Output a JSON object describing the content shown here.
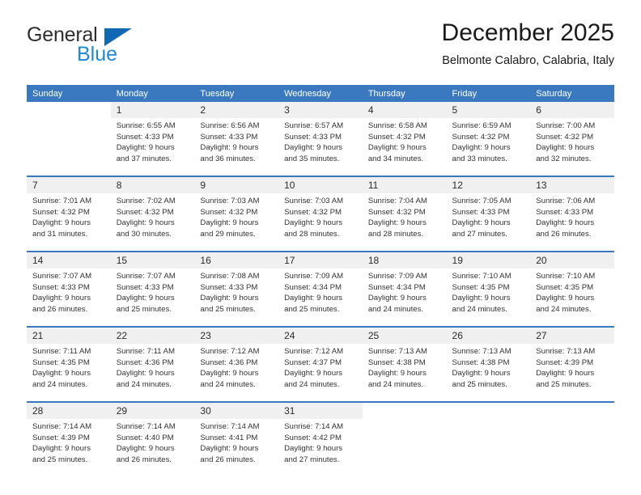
{
  "brand": {
    "name_part1": "General",
    "name_part2": "Blue",
    "triangle_color": "#1268b3",
    "blue_text_color": "#1e88d8"
  },
  "header": {
    "title": "December 2025",
    "location": "Belmonte Calabro, Calabria, Italy"
  },
  "theme": {
    "header_row_bg": "#3a79bf",
    "daynum_bg": "#f0f0f0",
    "cell_bg": "#ffffff",
    "text": "#333333"
  },
  "weekdays": [
    "Sunday",
    "Monday",
    "Tuesday",
    "Wednesday",
    "Thursday",
    "Friday",
    "Saturday"
  ],
  "weeks": [
    [
      {
        "day": "",
        "sunrise": "",
        "sunset": "",
        "daylight_line1": "",
        "daylight_line2": ""
      },
      {
        "day": "1",
        "sunrise": "Sunrise: 6:55 AM",
        "sunset": "Sunset: 4:33 PM",
        "daylight_line1": "Daylight: 9 hours",
        "daylight_line2": "and 37 minutes."
      },
      {
        "day": "2",
        "sunrise": "Sunrise: 6:56 AM",
        "sunset": "Sunset: 4:33 PM",
        "daylight_line1": "Daylight: 9 hours",
        "daylight_line2": "and 36 minutes."
      },
      {
        "day": "3",
        "sunrise": "Sunrise: 6:57 AM",
        "sunset": "Sunset: 4:33 PM",
        "daylight_line1": "Daylight: 9 hours",
        "daylight_line2": "and 35 minutes."
      },
      {
        "day": "4",
        "sunrise": "Sunrise: 6:58 AM",
        "sunset": "Sunset: 4:32 PM",
        "daylight_line1": "Daylight: 9 hours",
        "daylight_line2": "and 34 minutes."
      },
      {
        "day": "5",
        "sunrise": "Sunrise: 6:59 AM",
        "sunset": "Sunset: 4:32 PM",
        "daylight_line1": "Daylight: 9 hours",
        "daylight_line2": "and 33 minutes."
      },
      {
        "day": "6",
        "sunrise": "Sunrise: 7:00 AM",
        "sunset": "Sunset: 4:32 PM",
        "daylight_line1": "Daylight: 9 hours",
        "daylight_line2": "and 32 minutes."
      }
    ],
    [
      {
        "day": "7",
        "sunrise": "Sunrise: 7:01 AM",
        "sunset": "Sunset: 4:32 PM",
        "daylight_line1": "Daylight: 9 hours",
        "daylight_line2": "and 31 minutes."
      },
      {
        "day": "8",
        "sunrise": "Sunrise: 7:02 AM",
        "sunset": "Sunset: 4:32 PM",
        "daylight_line1": "Daylight: 9 hours",
        "daylight_line2": "and 30 minutes."
      },
      {
        "day": "9",
        "sunrise": "Sunrise: 7:03 AM",
        "sunset": "Sunset: 4:32 PM",
        "daylight_line1": "Daylight: 9 hours",
        "daylight_line2": "and 29 minutes."
      },
      {
        "day": "10",
        "sunrise": "Sunrise: 7:03 AM",
        "sunset": "Sunset: 4:32 PM",
        "daylight_line1": "Daylight: 9 hours",
        "daylight_line2": "and 28 minutes."
      },
      {
        "day": "11",
        "sunrise": "Sunrise: 7:04 AM",
        "sunset": "Sunset: 4:32 PM",
        "daylight_line1": "Daylight: 9 hours",
        "daylight_line2": "and 28 minutes."
      },
      {
        "day": "12",
        "sunrise": "Sunrise: 7:05 AM",
        "sunset": "Sunset: 4:33 PM",
        "daylight_line1": "Daylight: 9 hours",
        "daylight_line2": "and 27 minutes."
      },
      {
        "day": "13",
        "sunrise": "Sunrise: 7:06 AM",
        "sunset": "Sunset: 4:33 PM",
        "daylight_line1": "Daylight: 9 hours",
        "daylight_line2": "and 26 minutes."
      }
    ],
    [
      {
        "day": "14",
        "sunrise": "Sunrise: 7:07 AM",
        "sunset": "Sunset: 4:33 PM",
        "daylight_line1": "Daylight: 9 hours",
        "daylight_line2": "and 26 minutes."
      },
      {
        "day": "15",
        "sunrise": "Sunrise: 7:07 AM",
        "sunset": "Sunset: 4:33 PM",
        "daylight_line1": "Daylight: 9 hours",
        "daylight_line2": "and 25 minutes."
      },
      {
        "day": "16",
        "sunrise": "Sunrise: 7:08 AM",
        "sunset": "Sunset: 4:33 PM",
        "daylight_line1": "Daylight: 9 hours",
        "daylight_line2": "and 25 minutes."
      },
      {
        "day": "17",
        "sunrise": "Sunrise: 7:09 AM",
        "sunset": "Sunset: 4:34 PM",
        "daylight_line1": "Daylight: 9 hours",
        "daylight_line2": "and 25 minutes."
      },
      {
        "day": "18",
        "sunrise": "Sunrise: 7:09 AM",
        "sunset": "Sunset: 4:34 PM",
        "daylight_line1": "Daylight: 9 hours",
        "daylight_line2": "and 24 minutes."
      },
      {
        "day": "19",
        "sunrise": "Sunrise: 7:10 AM",
        "sunset": "Sunset: 4:35 PM",
        "daylight_line1": "Daylight: 9 hours",
        "daylight_line2": "and 24 minutes."
      },
      {
        "day": "20",
        "sunrise": "Sunrise: 7:10 AM",
        "sunset": "Sunset: 4:35 PM",
        "daylight_line1": "Daylight: 9 hours",
        "daylight_line2": "and 24 minutes."
      }
    ],
    [
      {
        "day": "21",
        "sunrise": "Sunrise: 7:11 AM",
        "sunset": "Sunset: 4:35 PM",
        "daylight_line1": "Daylight: 9 hours",
        "daylight_line2": "and 24 minutes."
      },
      {
        "day": "22",
        "sunrise": "Sunrise: 7:11 AM",
        "sunset": "Sunset: 4:36 PM",
        "daylight_line1": "Daylight: 9 hours",
        "daylight_line2": "and 24 minutes."
      },
      {
        "day": "23",
        "sunrise": "Sunrise: 7:12 AM",
        "sunset": "Sunset: 4:36 PM",
        "daylight_line1": "Daylight: 9 hours",
        "daylight_line2": "and 24 minutes."
      },
      {
        "day": "24",
        "sunrise": "Sunrise: 7:12 AM",
        "sunset": "Sunset: 4:37 PM",
        "daylight_line1": "Daylight: 9 hours",
        "daylight_line2": "and 24 minutes."
      },
      {
        "day": "25",
        "sunrise": "Sunrise: 7:13 AM",
        "sunset": "Sunset: 4:38 PM",
        "daylight_line1": "Daylight: 9 hours",
        "daylight_line2": "and 24 minutes."
      },
      {
        "day": "26",
        "sunrise": "Sunrise: 7:13 AM",
        "sunset": "Sunset: 4:38 PM",
        "daylight_line1": "Daylight: 9 hours",
        "daylight_line2": "and 25 minutes."
      },
      {
        "day": "27",
        "sunrise": "Sunrise: 7:13 AM",
        "sunset": "Sunset: 4:39 PM",
        "daylight_line1": "Daylight: 9 hours",
        "daylight_line2": "and 25 minutes."
      }
    ],
    [
      {
        "day": "28",
        "sunrise": "Sunrise: 7:14 AM",
        "sunset": "Sunset: 4:39 PM",
        "daylight_line1": "Daylight: 9 hours",
        "daylight_line2": "and 25 minutes."
      },
      {
        "day": "29",
        "sunrise": "Sunrise: 7:14 AM",
        "sunset": "Sunset: 4:40 PM",
        "daylight_line1": "Daylight: 9 hours",
        "daylight_line2": "and 26 minutes."
      },
      {
        "day": "30",
        "sunrise": "Sunrise: 7:14 AM",
        "sunset": "Sunset: 4:41 PM",
        "daylight_line1": "Daylight: 9 hours",
        "daylight_line2": "and 26 minutes."
      },
      {
        "day": "31",
        "sunrise": "Sunrise: 7:14 AM",
        "sunset": "Sunset: 4:42 PM",
        "daylight_line1": "Daylight: 9 hours",
        "daylight_line2": "and 27 minutes."
      },
      {
        "day": "",
        "sunrise": "",
        "sunset": "",
        "daylight_line1": "",
        "daylight_line2": ""
      },
      {
        "day": "",
        "sunrise": "",
        "sunset": "",
        "daylight_line1": "",
        "daylight_line2": ""
      },
      {
        "day": "",
        "sunrise": "",
        "sunset": "",
        "daylight_line1": "",
        "daylight_line2": ""
      }
    ]
  ]
}
